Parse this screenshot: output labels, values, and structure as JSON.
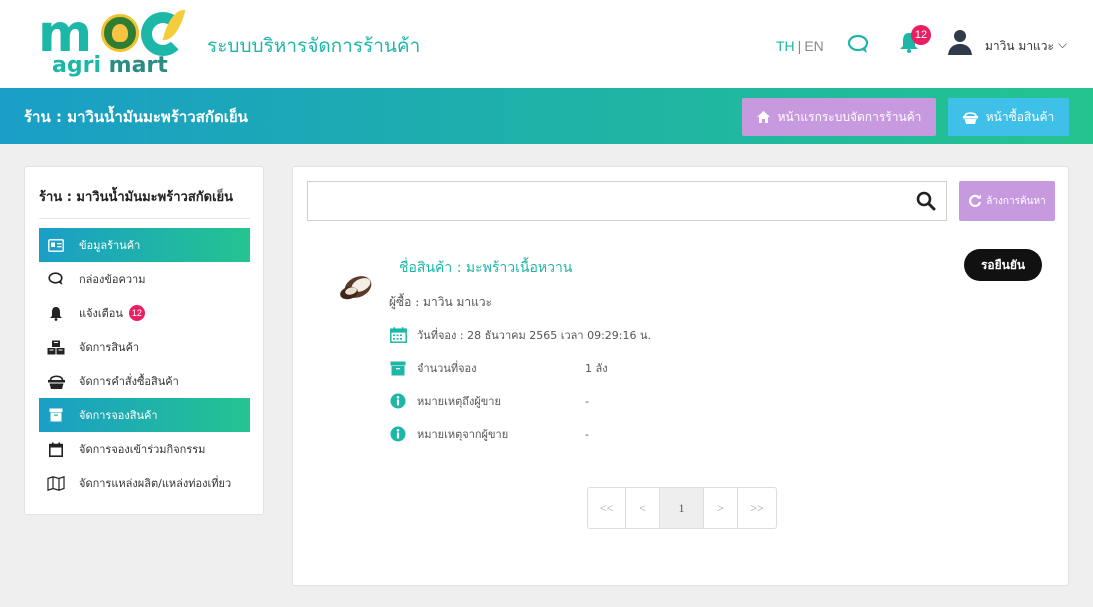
{
  "header": {
    "logo_text_agri": "agri",
    "logo_text_mart": "mart",
    "system_title": "ระบบบริหารจัดการร้านค้า",
    "lang_th": "TH",
    "lang_sep": "|",
    "lang_en": "EN",
    "notification_count": "12",
    "user_name": "มาวิน มาแวะ",
    "user_caret": "⌵",
    "icons": [
      "chat-icon",
      "bell-icon",
      "user-icon"
    ]
  },
  "bar": {
    "store_title": "ร้าน : มาวินน้ำมันมะพร้าวสกัดเย็น",
    "home_button": "หน้าแรกระบบจัดการร้านค้า",
    "shop_button": "หน้าซื้อสินค้า"
  },
  "sidebar": {
    "title": "ร้าน : มาวินน้ำมันมะพร้าวสกัดเย็น",
    "items": [
      {
        "label": "ข้อมูลร้านค้า",
        "icon": "id-card-icon",
        "active": true
      },
      {
        "label": "กล่องข้อความ",
        "icon": "chat-icon",
        "active": false
      },
      {
        "label": "แจ้งเตือน",
        "icon": "bell-icon",
        "active": false,
        "badge": "12"
      },
      {
        "label": "จัดการสินค้า",
        "icon": "cubes-icon",
        "active": false
      },
      {
        "label": "จัดการคำสั่งซื้อสินค้า",
        "icon": "basket-icon",
        "active": false
      },
      {
        "label": "จัดการจองสินค้า",
        "icon": "archive-icon",
        "active": true
      },
      {
        "label": "จัดการจองเข้าร่วมกิจกรรม",
        "icon": "calendar-icon",
        "active": false
      },
      {
        "label": "จัดการแหล่งผลิต/แหล่งท่องเที่ยว",
        "icon": "map-icon",
        "active": false
      }
    ]
  },
  "main": {
    "search": {
      "placeholder": "",
      "value": ""
    },
    "clear_button": "ล้างการค้นหา",
    "reservation": {
      "product_name": "ชื่อสินค้า : มะพร้าวเนื้อหวาน",
      "status": "รอยืนยัน",
      "buyer": "ผู้ซื้อ : มาวิน มาแวะ",
      "rows": [
        {
          "icon": "calendar-icon",
          "label": "วันที่จอง : 28 ธันวาคม 2565 เวลา 09:29:16 น.",
          "value": ""
        },
        {
          "icon": "archive-icon",
          "label": "จำนวนที่จอง",
          "value": "1 ลัง"
        },
        {
          "icon": "info-icon",
          "label": "หมายเหตุถึงผู้ขาย",
          "value": "-"
        },
        {
          "icon": "info-icon",
          "label": "หมายเหตุจากผู้ขาย",
          "value": "-"
        }
      ]
    },
    "pagination": {
      "first": "<<",
      "prev": "<",
      "current": "1",
      "next": ">",
      "last": ">>"
    }
  },
  "colors": {
    "brand": "#1db7a8",
    "purple_button": "#c79ae0",
    "blue_button": "#3fc0e8",
    "badge": "#e91e63"
  }
}
